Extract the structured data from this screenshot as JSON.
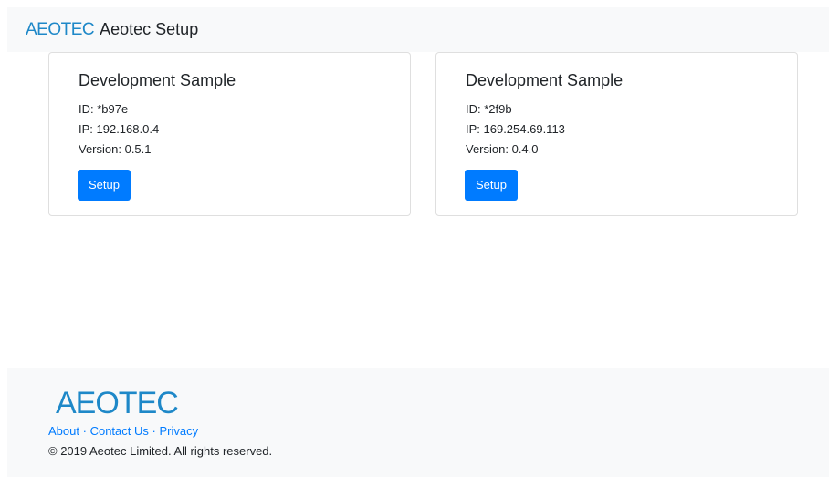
{
  "header": {
    "logo_text": "AEOTEC",
    "title": "Aeotec Setup"
  },
  "devices": [
    {
      "name": "Development Sample",
      "id_line": "ID: *b97e",
      "ip_line": "IP: 192.168.0.4",
      "version_line": "Version: 0.5.1",
      "button_label": "Setup"
    },
    {
      "name": "Development Sample",
      "id_line": "ID: *2f9b",
      "ip_line": "IP: 169.254.69.113",
      "version_line": "Version: 0.4.0",
      "button_label": "Setup"
    }
  ],
  "footer": {
    "logo_text": "AEOTEC",
    "links": [
      "About",
      "Contact Us",
      "Privacy"
    ],
    "separator": "·",
    "copyright": "© 2019 Aeotec Limited. All rights reserved."
  },
  "colors": {
    "brand": "#1e88c8",
    "primary": "#007bff",
    "bar_bg": "#f8f9fa"
  }
}
